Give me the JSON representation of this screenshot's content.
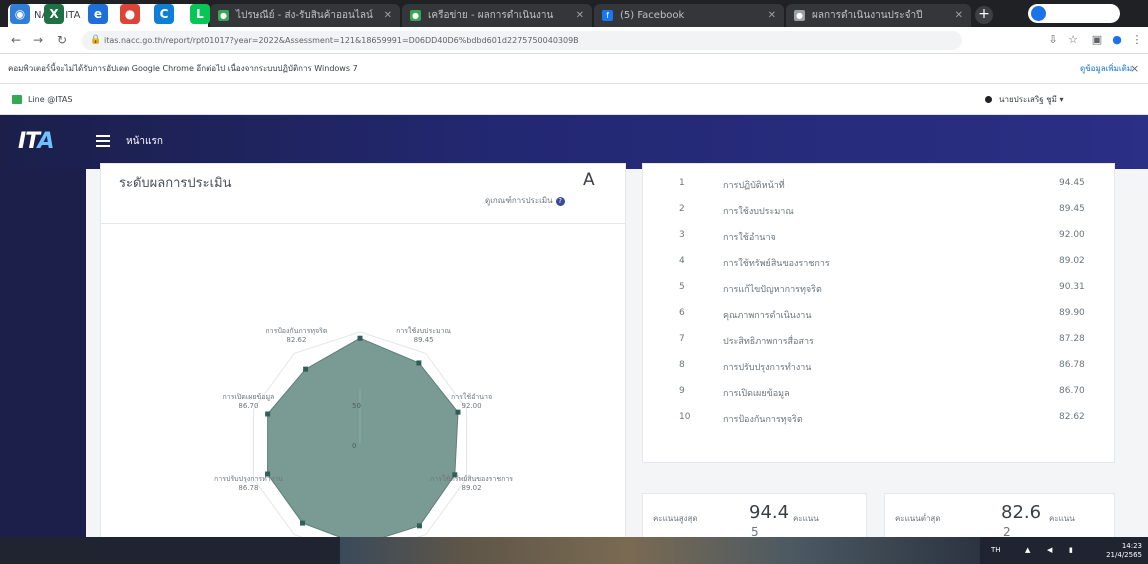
{
  "browser": {
    "tabs": [
      {
        "label": "NACC ITA",
        "active": true,
        "icon_color": "#3a4a9a"
      },
      {
        "label": "ไปรษณีย์ - ส่ง-รับสินค้าออนไลน์",
        "active": false,
        "icon_color": "#34a853"
      },
      {
        "label": "เครือข่าย - ผลการดำเนินงาน",
        "active": false,
        "icon_color": "#34a853"
      },
      {
        "label": "(5) Facebook",
        "active": false,
        "icon_color": "#1877f2"
      },
      {
        "label": "ผลการดำเนินงานประจำปี",
        "active": false,
        "icon_color": "#9aa0a6"
      }
    ],
    "new_tab_symbol": "+",
    "url": "itas.nacc.go.th/report/rpt01017?year=2022&Assessment=121&18659991=D06DD40D6%bdbd601d2275750040309B",
    "info_message": "คอมพิวเตอร์นี้จะไม่ได้รับการอัปเดต Google Chrome อีกต่อไป เนื่องจากระบบปฏิบัติการ Windows 7",
    "info_link": "ดูข้อมูลเพิ่มเติม",
    "info_close": "×",
    "bookmark_label": "Line @ITAS",
    "user_label": "นายประเสริฐ ชูมี ▾"
  },
  "app": {
    "logo_main": "IT",
    "logo_accent": "A",
    "title": "หน้าแรก"
  },
  "grade_card": {
    "label": "ระดับผลการประเมิน",
    "grade": "A",
    "criteria_link": "ดูเกณฑ์การประเมิน"
  },
  "chart_data": {
    "type": "radar",
    "axes": [
      "การปฏิบัติหน้าที่",
      "การใช้งบประมาณ",
      "การใช้อำนาจ",
      "การใช้ทรัพย์สินของราชการ",
      "การแก้ไขปัญหาการทุจริต",
      "คุณภาพการดำเนินงาน",
      "ประสิทธิภาพการสื่อสาร",
      "การปรับปรุงการทำงาน",
      "การเปิดเผยข้อมูล",
      "การป้องกันการทุจริต"
    ],
    "values": [
      94.45,
      89.45,
      92.0,
      89.02,
      90.31,
      89.9,
      87.28,
      86.78,
      86.7,
      82.62
    ],
    "value_labels": [
      "94.45",
      "89.45",
      "92.00",
      "89.02",
      "90.31",
      "89.90",
      "87.28",
      "86.78",
      "86.70",
      "82.62"
    ],
    "rlim": [
      0,
      100
    ],
    "inner_ring_labels": [
      "50",
      "0"
    ],
    "fill_color": "#7a9b94",
    "ring_color": "#e3e6e8"
  },
  "scores_table": {
    "rows": [
      {
        "num": "1",
        "name": "การปฏิบัติหน้าที่",
        "value": "94.45"
      },
      {
        "num": "2",
        "name": "การใช้งบประมาณ",
        "value": "89.45"
      },
      {
        "num": "3",
        "name": "การใช้อำนาจ",
        "value": "92.00"
      },
      {
        "num": "4",
        "name": "การใช้ทรัพย์สินของราชการ",
        "value": "89.02"
      },
      {
        "num": "5",
        "name": "การแก้ไขปัญหาการทุจริต",
        "value": "90.31"
      },
      {
        "num": "6",
        "name": "คุณภาพการดำเนินงาน",
        "value": "89.90"
      },
      {
        "num": "7",
        "name": "ประสิทธิภาพการสื่อสาร",
        "value": "87.28"
      },
      {
        "num": "8",
        "name": "การปรับปรุงการทำงาน",
        "value": "86.78"
      },
      {
        "num": "9",
        "name": "การเปิดเผยข้อมูล",
        "value": "86.70"
      },
      {
        "num": "10",
        "name": "การป้องกันการทุจริต",
        "value": "82.62"
      }
    ]
  },
  "stats": {
    "max": {
      "label": "คะแนนสูงสุด",
      "value": "94.4",
      "sub_label": "คะแนน",
      "sub_value": "5"
    },
    "min": {
      "label": "คะแนนต่ำสุด",
      "value": "82.6",
      "sub_label": "คะแนน",
      "sub_value": "2"
    }
  },
  "taskbar": {
    "items": [
      {
        "name": "start-button",
        "glyph": "◉",
        "color": "#2f7fd6"
      },
      {
        "name": "taskbar-excel",
        "glyph": "X",
        "color": "#1e7145"
      },
      {
        "name": "taskbar-ie",
        "glyph": "e",
        "color": "#1e6fd9"
      },
      {
        "name": "taskbar-chrome",
        "glyph": "●",
        "color": "#db4437"
      },
      {
        "name": "taskbar-edge",
        "glyph": "C",
        "color": "#0f7fd6"
      },
      {
        "name": "taskbar-line",
        "glyph": "L",
        "color": "#06c755"
      }
    ],
    "tray_lang": "TH",
    "clock_time": "14:23",
    "clock_date": "21/4/2565"
  }
}
